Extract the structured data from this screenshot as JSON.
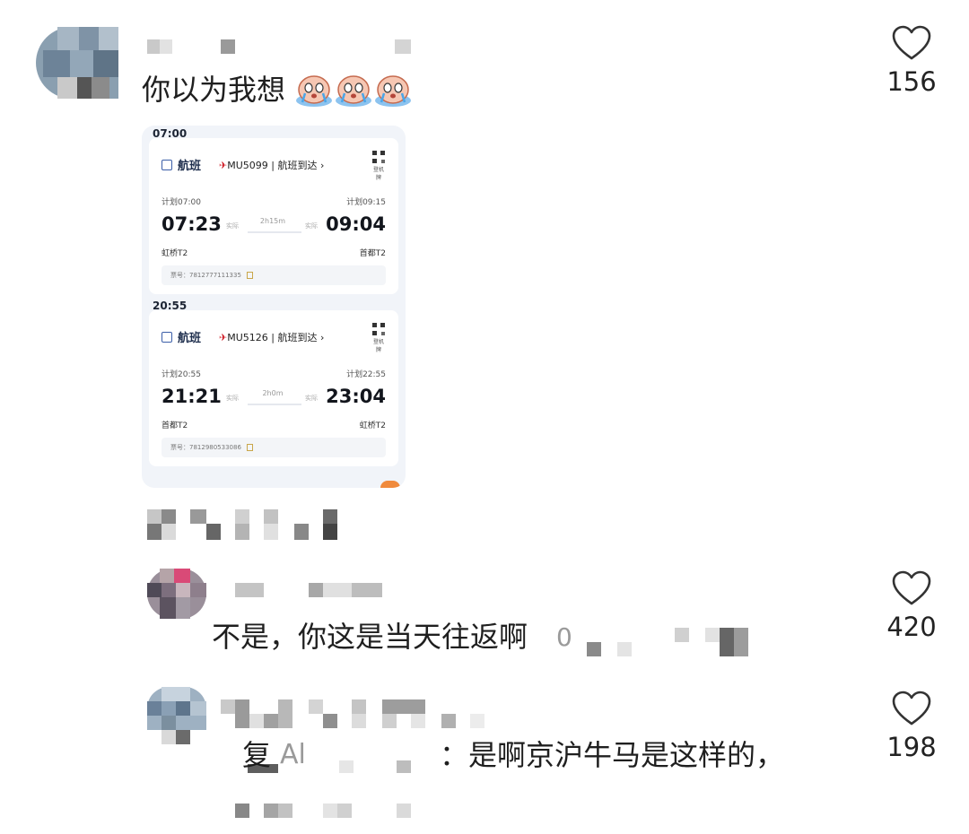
{
  "comments": [
    {
      "text_prefix": "你以为我想",
      "emojis": [
        "crying-emoji",
        "crying-emoji",
        "crying-emoji"
      ],
      "likes": "156"
    },
    {
      "text": "不是，你这是当天往返啊",
      "inline_value": "0",
      "likes": "420"
    },
    {
      "reply_prefix": "复",
      "mention_partial": "Al",
      "text": "：是啊京沪牛马是这样的，",
      "likes": "198"
    }
  ],
  "screenshot": {
    "sections": [
      {
        "time_header": "07:00",
        "tab_label": "航班",
        "flight_no": "MU5099",
        "status": "航班到达",
        "qr_label": "登机牌",
        "plan_dep": "计划07:00",
        "plan_arr": "计划09:15",
        "act_dep": "07:23",
        "act_arr": "09:04",
        "dep_small": "实际",
        "arr_small": "实际",
        "duration": "2h15m",
        "dep_terminal": "虹桥T2",
        "arr_terminal": "首都T2",
        "ticket": "票号：7812777111335"
      },
      {
        "time_header": "20:55",
        "tab_label": "航班",
        "flight_no": "MU5126",
        "status": "航班到达",
        "qr_label": "登机牌",
        "plan_dep": "计划20:55",
        "plan_arr": "计划22:55",
        "act_dep": "21:21",
        "act_arr": "23:04",
        "dep_small": "实际",
        "arr_small": "实际",
        "duration": "2h0m",
        "dep_terminal": "首都T2",
        "arr_terminal": "虹桥T2",
        "ticket": "票号：7812980533086"
      }
    ]
  },
  "colors": {
    "accent_red": "#d0202a",
    "count_text": "#222222",
    "pixel_gray_dark": "#777777",
    "pixel_gray_light": "#d6d6d6"
  },
  "icons": [
    "heart-outline-icon",
    "qr-code-icon",
    "copy-icon",
    "plane-icon"
  ]
}
